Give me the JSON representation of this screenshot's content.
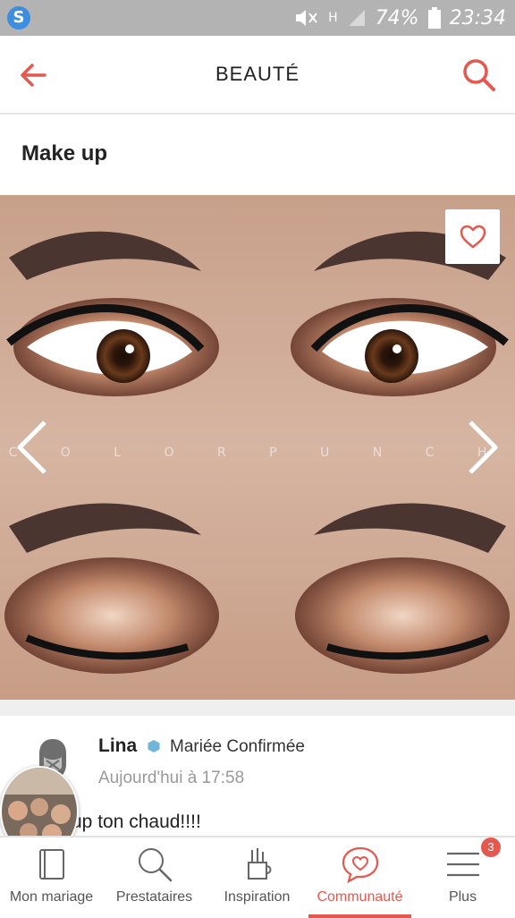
{
  "status_bar": {
    "battery": "74%",
    "time": "23:34",
    "network": "H"
  },
  "app_bar": {
    "title": "BEAUTÉ"
  },
  "section": {
    "title": "Make up"
  },
  "photo": {
    "watermark": "C O L O R P U N C H"
  },
  "comment": {
    "author": "Lina",
    "badge": "Mariée Confirmée",
    "timestamp": "Aujourd'hui à 17:58",
    "text": "up ton chaud!!!!"
  },
  "bottom_nav": {
    "items": [
      {
        "label": "Mon mariage"
      },
      {
        "label": "Prestataires"
      },
      {
        "label": "Inspiration"
      },
      {
        "label": "Communauté"
      },
      {
        "label": "Plus"
      }
    ],
    "active_index": 3,
    "notification_count": "3"
  },
  "colors": {
    "accent": "#e4584f",
    "badge_blue": "#6fb6d8"
  }
}
